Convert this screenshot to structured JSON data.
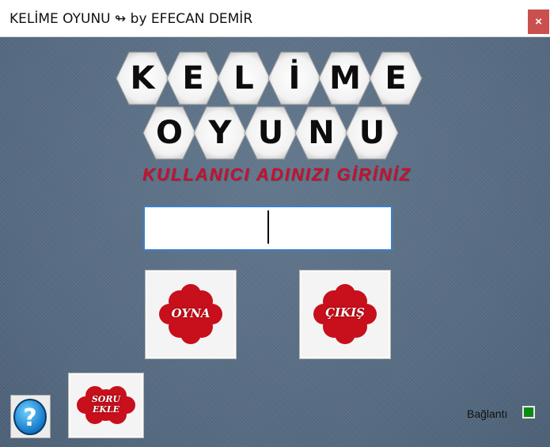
{
  "window": {
    "title": "KELİME OYUNU ↬ by EFECAN DEMİR",
    "close_label": "×"
  },
  "logo": {
    "row1": [
      "K",
      "E",
      "L",
      "İ",
      "M",
      "E"
    ],
    "row2": [
      "O",
      "Y",
      "U",
      "N",
      "U"
    ]
  },
  "prompt": "KULLANICI ADINIZI GİRİNİZ",
  "username": {
    "value": "",
    "placeholder": ""
  },
  "buttons": {
    "play": "OYNA",
    "exit": "ÇIKIŞ",
    "add_question_line1": "SORU",
    "add_question_line2": "EKLE"
  },
  "help": {
    "icon": "question-mark-icon",
    "glyph": "?"
  },
  "status": {
    "label": "Bağlantı",
    "connected": true,
    "color": "#0a8a14"
  },
  "colors": {
    "accent_red": "#c8102e",
    "close_red": "#c9504f",
    "background": "#5a7088"
  }
}
